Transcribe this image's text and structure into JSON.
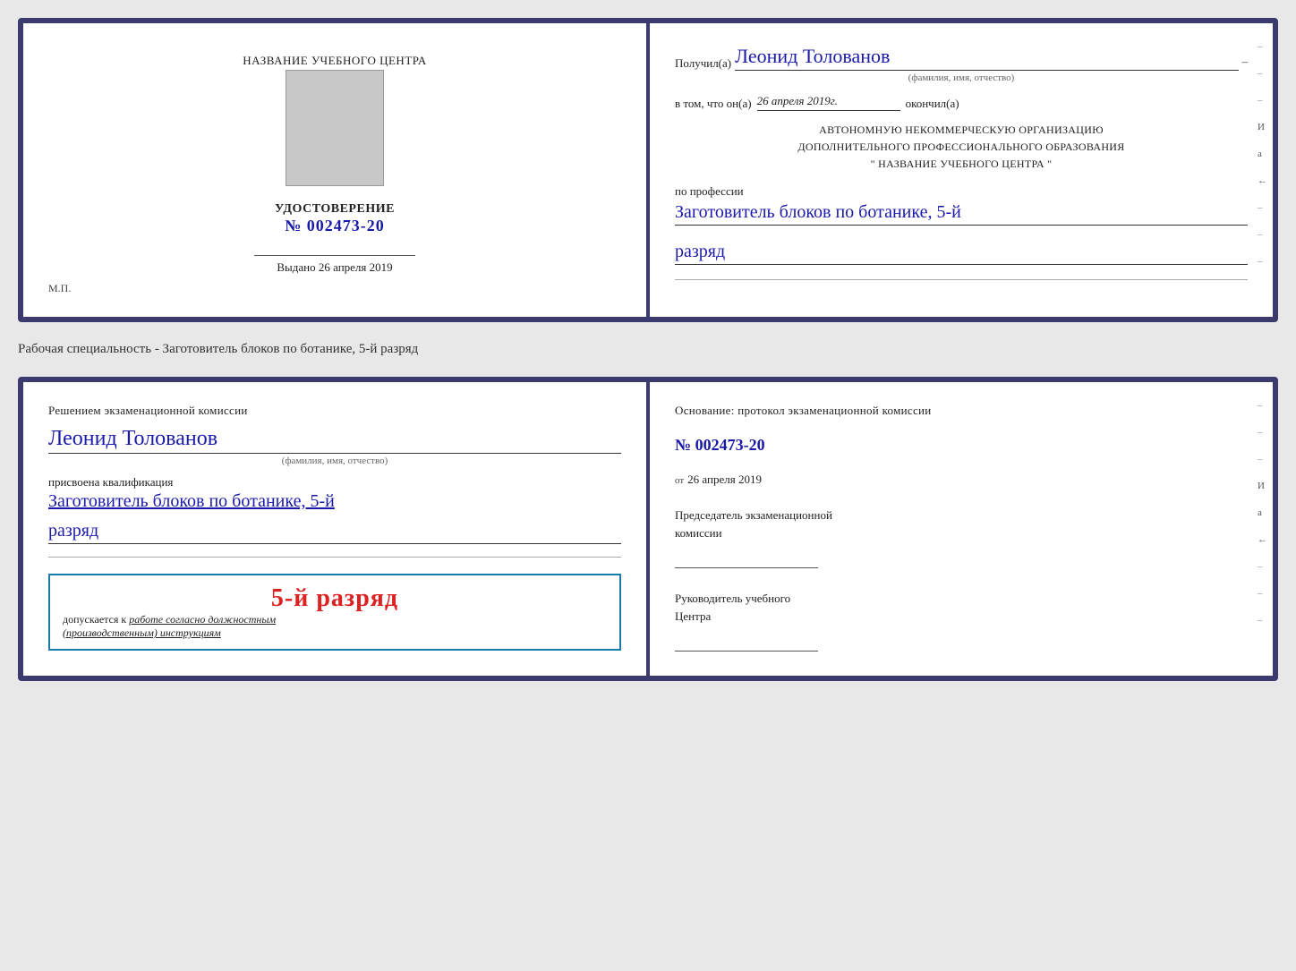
{
  "doc1": {
    "left": {
      "training_center_label": "НАЗВАНИЕ УЧЕБНОГО ЦЕНТРА",
      "cert_label": "УДОСТОВЕРЕНИЕ",
      "cert_number": "№ 002473-20",
      "issued_label": "Выдано",
      "issued_date": "26 апреля 2019",
      "stamp_label": "М.П."
    },
    "right": {
      "recipient_prefix": "Получил(а)",
      "recipient_name": "Леонид Толованов",
      "fio_subtext": "(фамилия, имя, отчество)",
      "date_prefix": "в том, что он(а)",
      "date_value": "26 апреля 2019г.",
      "date_suffix": "окончил(а)",
      "org_line1": "АВТОНОМНУЮ НЕКОММЕРЧЕСКУЮ ОРГАНИЗАЦИЮ",
      "org_line2": "ДОПОЛНИТЕЛЬНОГО ПРОФЕССИОНАЛЬНОГО ОБРАЗОВАНИЯ",
      "org_line3": "\" НАЗВАНИЕ УЧЕБНОГО ЦЕНТРА \"",
      "profession_prefix": "по профессии",
      "profession_value": "Заготовитель блоков по ботанике, 5-й",
      "rank_value": "разряд"
    }
  },
  "middle_label": "Рабочая специальность - Заготовитель блоков по ботанике, 5-й разряд",
  "doc2": {
    "left": {
      "decision_text": "Решением экзаменационной комиссии",
      "person_name": "Леонид Толованов",
      "fio_subtext": "(фамилия, имя, отчество)",
      "qualification_label": "присвоена квалификация",
      "qualification_value": "Заготовитель блоков по ботанике, 5-й",
      "rank_value": "разряд",
      "stamp_rank": "5-й разряд",
      "stamp_admitted": "допускается к",
      "stamp_work_italic": "работе согласно должностным",
      "stamp_instructions_italic": "(производственным) инструкциям"
    },
    "right": {
      "basis_text": "Основание: протокол экзаменационной комиссии",
      "protocol_number": "№ 002473-20",
      "from_prefix": "от",
      "from_date": "26 апреля 2019",
      "chairman_label1": "Председатель экзаменационной",
      "chairman_label2": "комиссии",
      "director_label1": "Руководитель учебного",
      "director_label2": "Центра"
    }
  },
  "side_marks": [
    "И",
    "а",
    "←",
    "–",
    "–",
    "–",
    "–",
    "–"
  ],
  "side_marks2": [
    "И",
    "а",
    "←",
    "–",
    "–",
    "–",
    "–",
    "–"
  ]
}
